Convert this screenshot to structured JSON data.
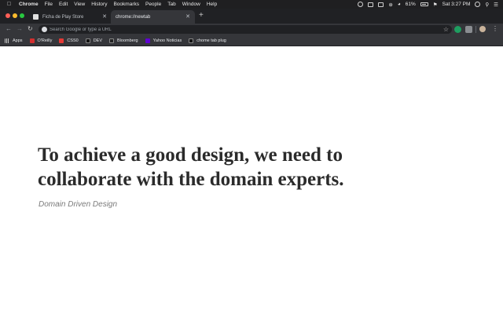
{
  "menubar": {
    "app": "Chrome",
    "items": [
      "File",
      "Edit",
      "View",
      "History",
      "Bookmarks",
      "People",
      "Tab",
      "Window",
      "Help"
    ],
    "battery": "61%",
    "clock": "Sat 3:27 PM"
  },
  "tabs": [
    {
      "title": "Ficha de Play Store",
      "active": false
    },
    {
      "title": "chrome://newtab",
      "active": true
    }
  ],
  "toolbar": {
    "search_placeholder": "Search Google or type a URL"
  },
  "bookmarks": [
    {
      "label": "Apps",
      "icon": "apps-grid-icon",
      "color": "#c8c8c8"
    },
    {
      "label": "O'Reilly",
      "icon": "oreilly-icon",
      "color": "#d32f2f"
    },
    {
      "label": "CSS0",
      "icon": "css-icon",
      "color": "#e53935"
    },
    {
      "label": "DEV",
      "icon": "dev-icon",
      "color": "#111111"
    },
    {
      "label": "Bloomberg",
      "icon": "bloomberg-icon",
      "color": "#222222"
    },
    {
      "label": "Yahoo Noticias",
      "icon": "yahoo-icon",
      "color": "#6001d2"
    },
    {
      "label": "chome tab plug",
      "icon": "medium-icon",
      "color": "#111111"
    }
  ],
  "content": {
    "quote_line1": "To achieve a good design, we need to",
    "quote_line2": "collaborate with the domain experts.",
    "source": "Domain Driven Design"
  }
}
